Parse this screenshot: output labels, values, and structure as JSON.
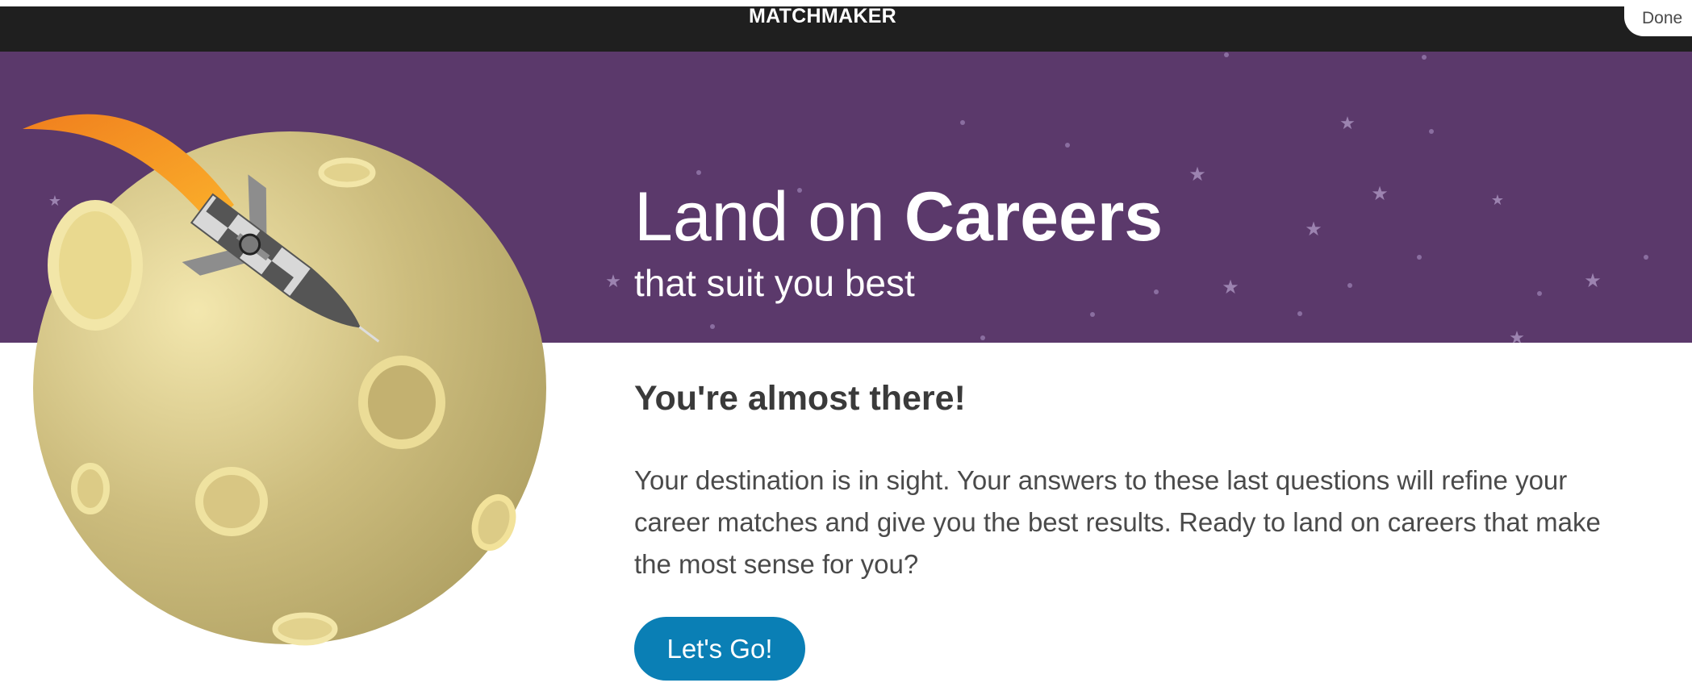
{
  "header": {
    "app_title": "MATCHMAKER",
    "done_label": "Done"
  },
  "hero": {
    "title_light": "Land on",
    "title_bold": "Careers",
    "subtitle": "that suit you best",
    "background_color": "#5b396b",
    "illustration": "moon-rocket-illustration"
  },
  "content": {
    "heading": "You're almost there!",
    "body": "Your destination is in sight. Your answers to these last questions will refine your career matches and give you the best results. Ready to land on careers that make the most sense for you?",
    "cta_label": "Let's Go!",
    "cta_color": "#0a7fb5"
  }
}
